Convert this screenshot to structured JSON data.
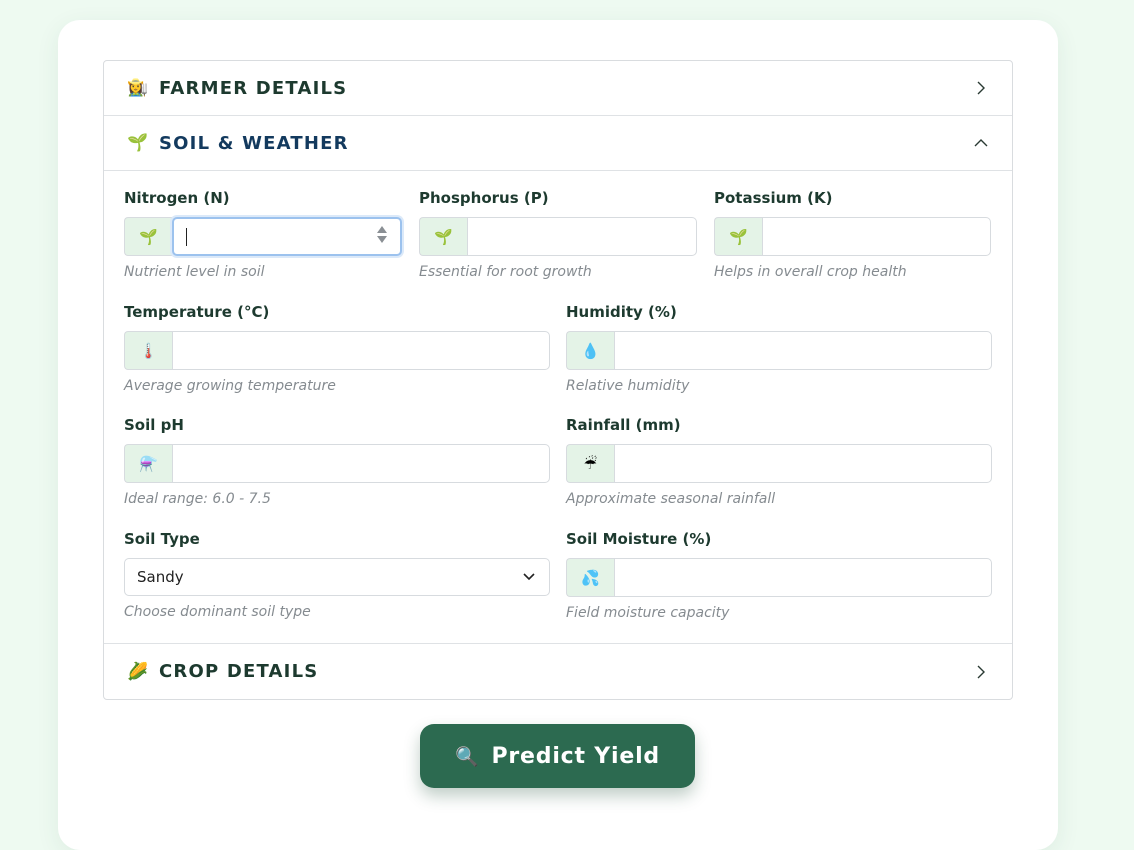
{
  "sections": {
    "farmer": {
      "title": "FARMER DETAILS",
      "icon": "👩‍🌾"
    },
    "soil": {
      "title": "SOIL & WEATHER",
      "icon": "🌱"
    },
    "crop": {
      "title": "CROP DETAILS",
      "icon": "🌽"
    }
  },
  "fields": {
    "nitrogen": {
      "label": "Nitrogen (N)",
      "icon": "🌱",
      "value": "",
      "help": "Nutrient level in soil"
    },
    "phosphorus": {
      "label": "Phosphorus (P)",
      "icon": "🌱",
      "value": "",
      "help": "Essential for root growth"
    },
    "potassium": {
      "label": "Potassium (K)",
      "icon": "🌱",
      "value": "",
      "help": "Helps in overall crop health"
    },
    "temperature": {
      "label": "Temperature (°C)",
      "icon": "🌡️",
      "value": "",
      "help": "Average growing temperature"
    },
    "humidity": {
      "label": "Humidity (%)",
      "icon": "💧",
      "value": "",
      "help": "Relative humidity"
    },
    "ph": {
      "label": "Soil pH",
      "icon": "⚗️",
      "value": "",
      "help": "Ideal range: 6.0 - 7.5"
    },
    "rainfall": {
      "label": "Rainfall (mm)",
      "icon": "☔",
      "value": "",
      "help": "Approximate seasonal rainfall"
    },
    "soil_type": {
      "label": "Soil Type",
      "selected": "Sandy",
      "help": "Choose dominant soil type"
    },
    "moisture": {
      "label": "Soil Moisture (%)",
      "icon": "💦",
      "value": "",
      "help": "Field moisture capacity"
    }
  },
  "predict": {
    "label": "Predict Yield",
    "icon": "🔍"
  },
  "colors": {
    "accent": "#2c6a50",
    "prefix_bg": "#e4f3e7",
    "page_bg": "#eefaf1"
  }
}
